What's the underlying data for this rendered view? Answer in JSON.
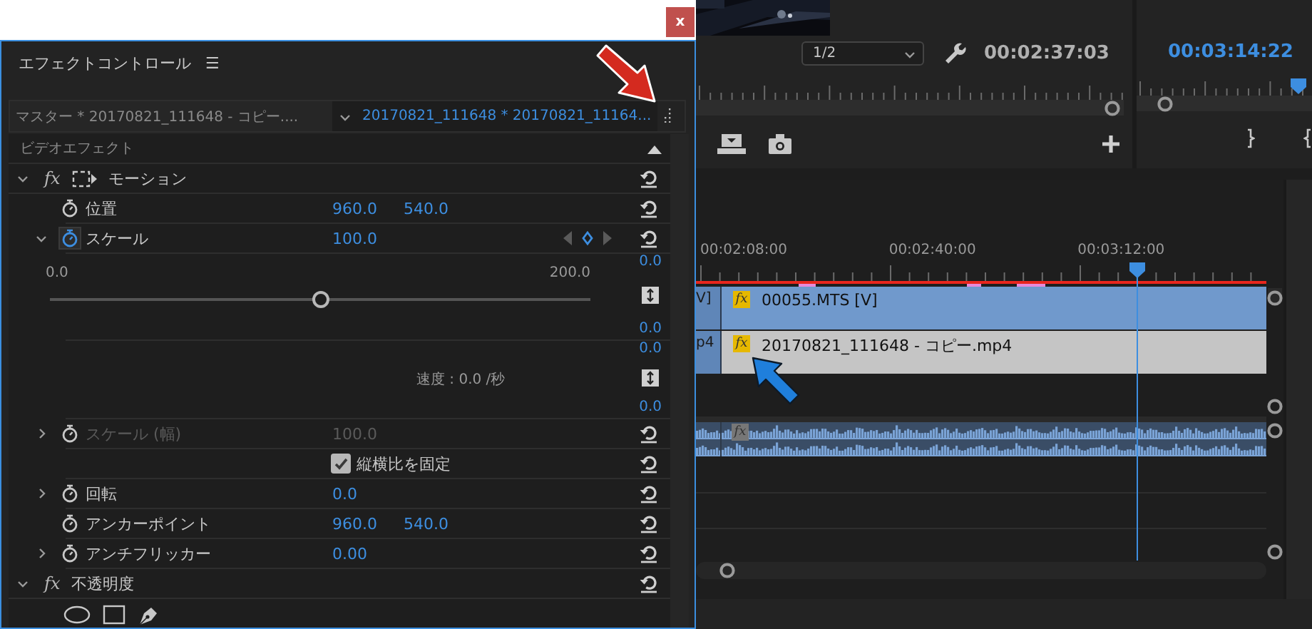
{
  "window": {
    "close_button": "x"
  },
  "effect_controls": {
    "title": "エフェクトコントロール",
    "menu_icon": "☰",
    "master_clip": "マスター * 20170821_111648 - コピー....",
    "sequence_clip": "20170821_111648 * 20170821_11164...",
    "section": "ビデオエフェクト",
    "rows": [
      {
        "kind": "transform_effect",
        "badge": "fx",
        "name": "モーション",
        "expanded": true
      },
      {
        "kind": "property",
        "name": "位置",
        "values": [
          "960.0",
          "540.0"
        ],
        "animated": false,
        "disabled": false
      },
      {
        "kind": "property",
        "name": "スケール",
        "values": [
          "100.0"
        ],
        "expanded": true,
        "animated": true,
        "disabled": false
      },
      {
        "kind": "slider",
        "min": "0.0",
        "max": "200.0",
        "level": 0.5,
        "top_value": "0.0",
        "bottom_value": "0.0"
      },
      {
        "kind": "velocity",
        "label": "速度 : 0.0 /秒",
        "top_value": "0.0",
        "bottom_value": "0.0"
      },
      {
        "kind": "property",
        "name": "スケール (幅)",
        "values": [
          "100.0"
        ],
        "expanded": false,
        "animated": false,
        "disabled": true
      },
      {
        "kind": "checkbox",
        "label": "縦横比を固定",
        "checked": true
      },
      {
        "kind": "property",
        "name": "回転",
        "values": [
          "0.0"
        ],
        "expanded": false,
        "animated": false,
        "disabled": false
      },
      {
        "kind": "property",
        "name": "アンカーポイント",
        "values": [
          "960.0",
          "540.0"
        ],
        "animated": false,
        "disabled": false
      },
      {
        "kind": "property",
        "name": "アンチフリッカー",
        "values": [
          "0.00"
        ],
        "expanded": false,
        "animated": false,
        "disabled": false
      },
      {
        "kind": "effect",
        "badge": "fx",
        "name": "不透明度",
        "expanded": true
      },
      {
        "kind": "mask_tools"
      }
    ]
  },
  "program_monitor": {
    "zoom": "1/2",
    "timecode": "00:02:37:03"
  },
  "source_monitor": {
    "timecode": "00:03:14:22"
  },
  "timeline": {
    "time_labels": [
      "00:02:08:00",
      "00:02:40:00",
      "00:03:12:00"
    ],
    "tracks": [
      {
        "kind": "video",
        "clip_prefix": "V]",
        "badge": "fx",
        "clip_name": "00055.MTS [V]",
        "selected": true
      },
      {
        "kind": "video",
        "clip_prefix": "p4",
        "badge": "fx",
        "clip_name": "20170821_111648  - コピー.mp4",
        "selected": false
      },
      {
        "kind": "empty"
      },
      {
        "kind": "audio",
        "badge": "fx"
      }
    ]
  }
}
